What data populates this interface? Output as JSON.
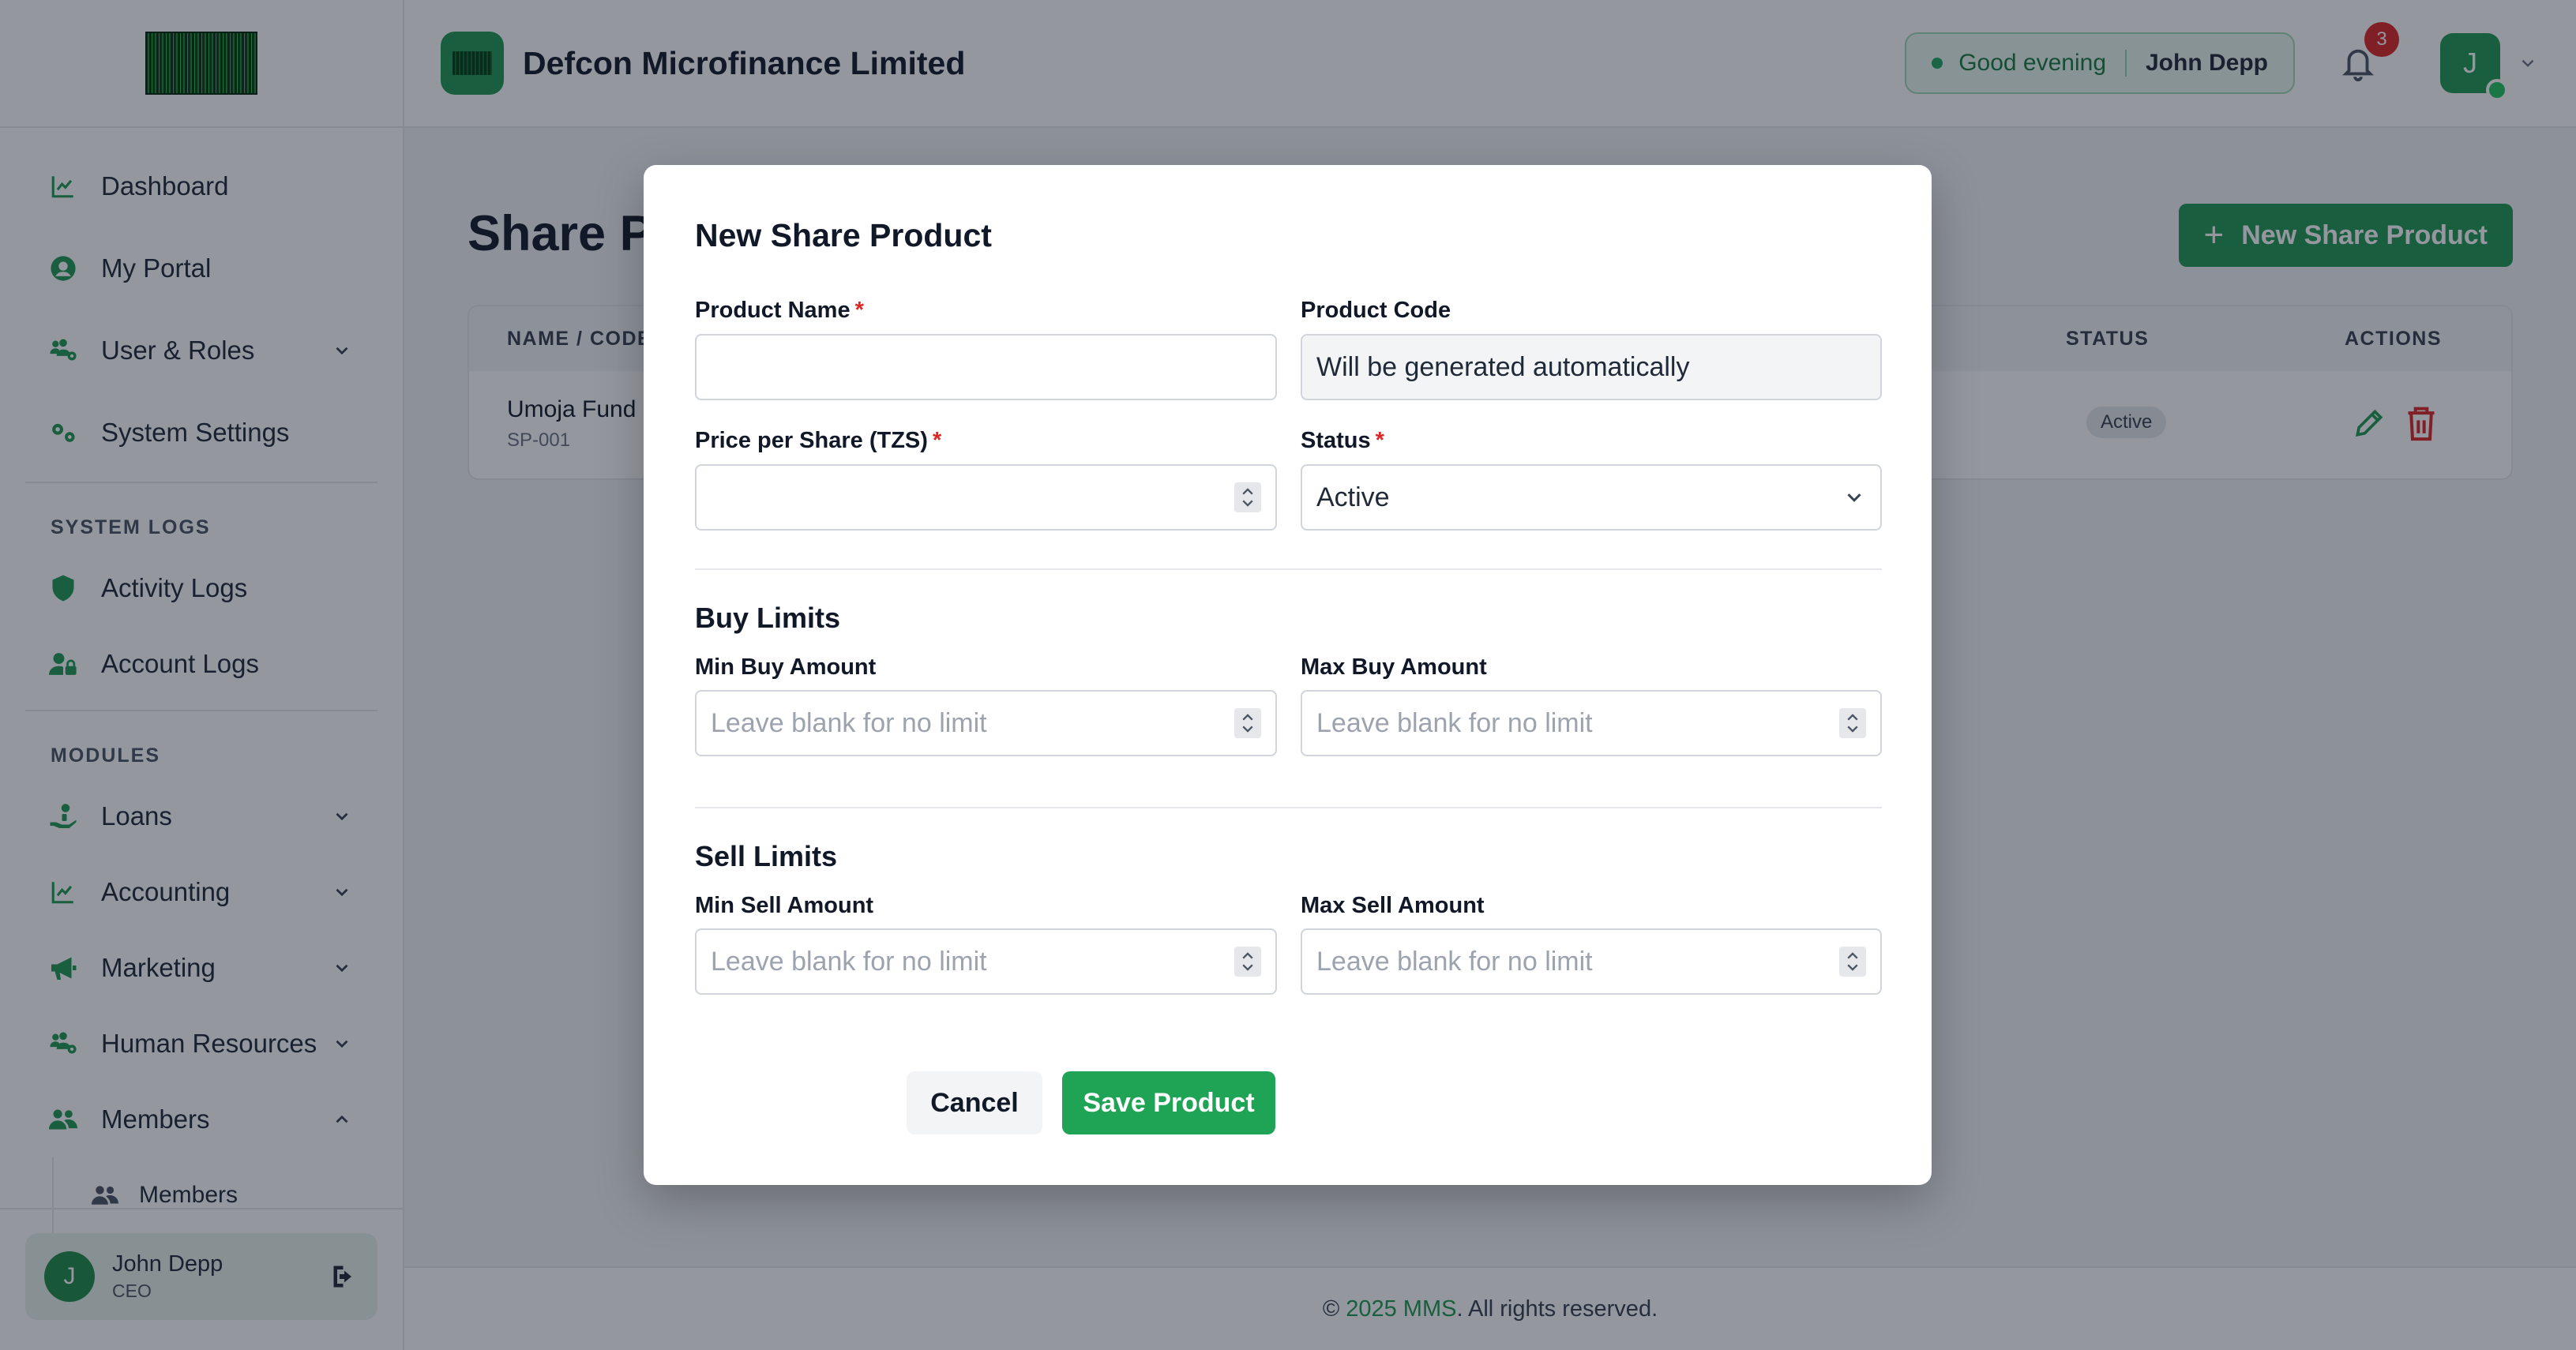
{
  "sidebar": {
    "nav": [
      {
        "label": "Dashboard",
        "icon": "chart-line-icon"
      },
      {
        "label": "My Portal",
        "icon": "user-circle-icon"
      },
      {
        "label": "User & Roles",
        "icon": "users-cog-icon"
      },
      {
        "label": "System Settings",
        "icon": "gears-icon"
      }
    ],
    "system_logs_label": "SYSTEM LOGS",
    "logs": [
      {
        "label": "Activity Logs",
        "icon": "shield-icon"
      },
      {
        "label": "Account Logs",
        "icon": "user-lock-icon"
      }
    ],
    "modules_label": "MODULES",
    "modules": [
      {
        "label": "Loans",
        "icon": "hand-coins-icon"
      },
      {
        "label": "Accounting",
        "icon": "chart-line-icon"
      },
      {
        "label": "Marketing",
        "icon": "megaphone-icon"
      },
      {
        "label": "Human Resources",
        "icon": "users-cog-icon"
      },
      {
        "label": "Members",
        "icon": "users-icon"
      }
    ],
    "members_sub": [
      {
        "label": "Members",
        "icon": "users-icon"
      }
    ],
    "user": {
      "initial": "J",
      "name": "John Depp",
      "role": "CEO"
    }
  },
  "header": {
    "org_name": "Defcon Microfinance Limited",
    "greeting": "Good evening",
    "greeting_user": "John Depp",
    "notification_count": "3",
    "avatar_initial": "J"
  },
  "main": {
    "page_title": "Share Products",
    "new_button": "New Share Product",
    "table": {
      "headers": {
        "name_code": "NAME / CODE",
        "status": "STATUS",
        "actions": "ACTIONS"
      },
      "rows": [
        {
          "name": "Umoja Fund",
          "code": "SP-001",
          "status": "Active"
        }
      ]
    }
  },
  "footer": {
    "copyright": "©",
    "brand": "2025 MMS",
    "rest": ". All rights reserved."
  },
  "modal": {
    "title": "New Share Product",
    "product_name_label": "Product Name",
    "product_name_value": "",
    "product_code_label": "Product Code",
    "product_code_value": "Will be generated automatically",
    "price_label": "Price per Share (TZS)",
    "price_value": "",
    "status_label": "Status",
    "status_value": "Active",
    "buy_limits_title": "Buy Limits",
    "min_buy_label": "Min Buy Amount",
    "max_buy_label": "Max Buy Amount",
    "sell_limits_title": "Sell Limits",
    "min_sell_label": "Min Sell Amount",
    "max_sell_label": "Max Sell Amount",
    "limit_placeholder": "Leave blank for no limit",
    "required_mark": "*",
    "cancel_label": "Cancel",
    "save_label": "Save Product"
  },
  "colors": {
    "brand": "#1f9a52",
    "danger": "#dc2626",
    "overlay": "rgba(17,24,39,0.45)"
  }
}
